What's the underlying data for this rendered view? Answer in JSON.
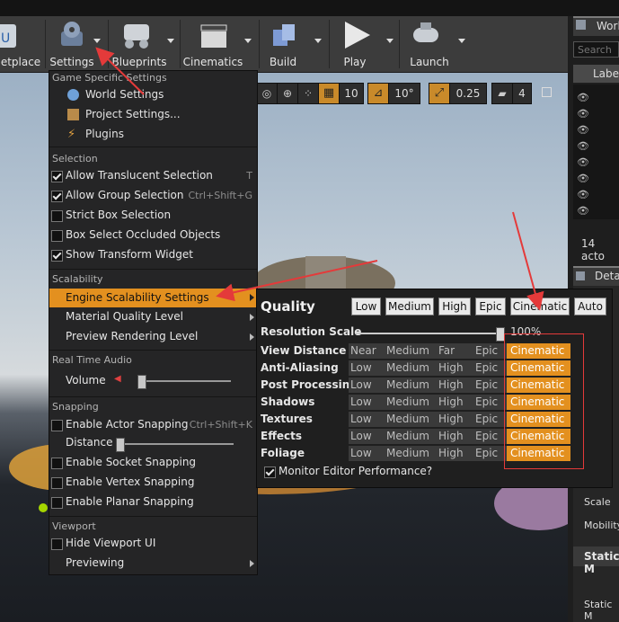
{
  "toolbar": {
    "buttons": [
      {
        "label": "etplace"
      },
      {
        "label": "Settings"
      },
      {
        "label": "Blueprints"
      },
      {
        "label": "Cinematics"
      },
      {
        "label": "Build"
      },
      {
        "label": "Play"
      },
      {
        "label": "Launch"
      }
    ]
  },
  "viewport_toolbar": {
    "grid": "10",
    "angle": "10°",
    "scale": "0.25",
    "camera": "4"
  },
  "right_panel": {
    "title": "Worl",
    "search_placeholder": "Search",
    "label_col": "Label",
    "actors": "14 acto",
    "details": "Deta",
    "scale": "Scale",
    "mobility": "Mobility",
    "static_m": "Static M",
    "static_m2": "Static M"
  },
  "menu": {
    "section_game": "Game Specific Settings",
    "world_settings": "World Settings",
    "project_settings": "Project Settings...",
    "plugins": "Plugins",
    "section_selection": "Selection",
    "allow_translucent": "Allow Translucent Selection",
    "allow_translucent_key": "T",
    "allow_group": "Allow Group Selection",
    "allow_group_key": "Ctrl+Shift+G",
    "strict_box": "Strict Box Selection",
    "box_occluded": "Box Select Occluded Objects",
    "show_transform": "Show Transform Widget",
    "section_scalability": "Scalability",
    "engine_scalability": "Engine Scalability Settings",
    "material_quality": "Material Quality Level",
    "preview_rendering": "Preview Rendering Level",
    "section_audio": "Real Time Audio",
    "volume": "Volume",
    "volume_level": 0.02,
    "section_snapping": "Snapping",
    "actor_snapping": "Enable Actor Snapping",
    "actor_snapping_key": "Ctrl+Shift+K",
    "distance": "Distance",
    "distance_level": 0.0,
    "socket_snapping": "Enable Socket Snapping",
    "vertex_snapping": "Enable Vertex Snapping",
    "planar_snapping": "Enable Planar Snapping",
    "section_viewport": "Viewport",
    "hide_viewport_ui": "Hide Viewport UI",
    "previewing": "Previewing"
  },
  "scalability": {
    "title": "Quality",
    "presets": [
      "Low",
      "Medium",
      "High",
      "Epic",
      "Cinematic",
      "Auto"
    ],
    "resolution_label": "Resolution Scale",
    "resolution_value": "100%",
    "resolution_level": 1.0,
    "rows": [
      {
        "label": "View Distance",
        "levels": [
          "Near",
          "Medium",
          "Far",
          "Epic",
          "Cinematic"
        ]
      },
      {
        "label": "Anti-Aliasing",
        "levels": [
          "Low",
          "Medium",
          "High",
          "Epic",
          "Cinematic"
        ]
      },
      {
        "label": "Post Processing",
        "levels": [
          "Low",
          "Medium",
          "High",
          "Epic",
          "Cinematic"
        ]
      },
      {
        "label": "Shadows",
        "levels": [
          "Low",
          "Medium",
          "High",
          "Epic",
          "Cinematic"
        ]
      },
      {
        "label": "Textures",
        "levels": [
          "Low",
          "Medium",
          "High",
          "Epic",
          "Cinematic"
        ]
      },
      {
        "label": "Effects",
        "levels": [
          "Low",
          "Medium",
          "High",
          "Epic",
          "Cinematic"
        ]
      },
      {
        "label": "Foliage",
        "levels": [
          "Low",
          "Medium",
          "High",
          "Epic",
          "Cinematic"
        ]
      }
    ],
    "monitor": "Monitor Editor Performance?"
  },
  "colors": {
    "accent": "#e3901f",
    "annotation": "#e43a3a"
  }
}
